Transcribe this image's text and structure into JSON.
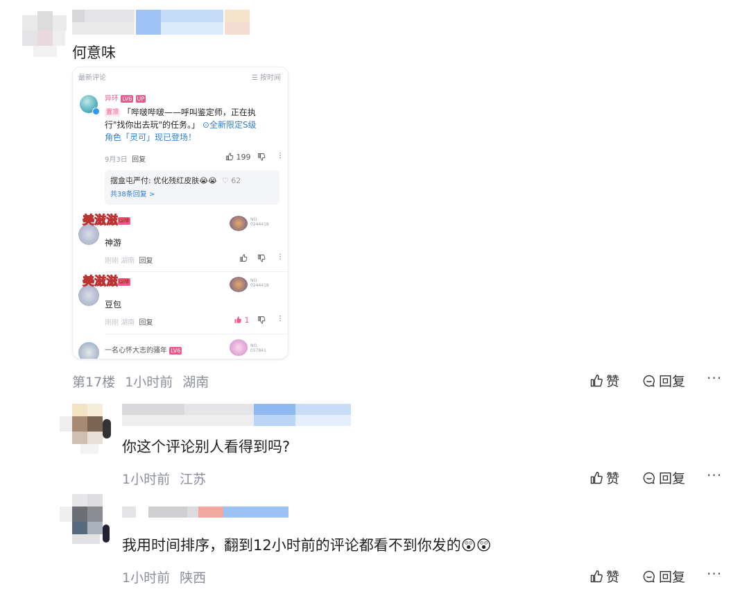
{
  "comment17": {
    "text": "何意味",
    "floor": "第17楼",
    "time": "1小时前",
    "location": "湖南"
  },
  "card": {
    "header_left": "最新评论",
    "header_right": "按时间",
    "c1": {
      "user": "异环",
      "level": "LV6",
      "up": "UP",
      "pin": "置顶",
      "text_a": "「哔啵哔啵——呼叫鉴定师，正在执",
      "text_b": "行\"找你出去玩\"的任务。」",
      "link_a": "全新限定S级",
      "link_b": "角色「灵可」现已登场！",
      "date": "9月3日",
      "reply": "回复",
      "likes": "199",
      "sub_reply": "摆盒屯严付: 优化残红皮肤😭😭",
      "sub_likes": "62",
      "more_replies": "共38条回复 >"
    },
    "c2": {
      "name_art": "美滋滋",
      "level": "LV6",
      "text": "神游",
      "time": "刚刚 湖南",
      "reply": "回复",
      "fan_no": "NO.\n0244418"
    },
    "c3": {
      "name_art": "美滋滋",
      "level": "LV6",
      "text": "豆包",
      "time": "刚刚 湖南",
      "reply": "回复",
      "likes": "1",
      "fan_no": "NO.\n0244418"
    },
    "c4": {
      "user": "一名心怀大志的骚年",
      "level": "LV6",
      "fan_no": "NO.\n057841"
    }
  },
  "reply1": {
    "text": "你这个评论别人看得到吗?",
    "time": "1小时前",
    "location": "江苏"
  },
  "reply2": {
    "text": "我用时间排序，翻到12小时前的评论都看不到你发的😲😲",
    "time": "1小时前",
    "location": "陕西"
  },
  "actions": {
    "like": "赞",
    "reply": "回复",
    "more": "···"
  },
  "colors": {
    "accent_blue": "#2f7fd8",
    "meta_gray": "#8a8f99",
    "like_pink": "#f0588c"
  }
}
